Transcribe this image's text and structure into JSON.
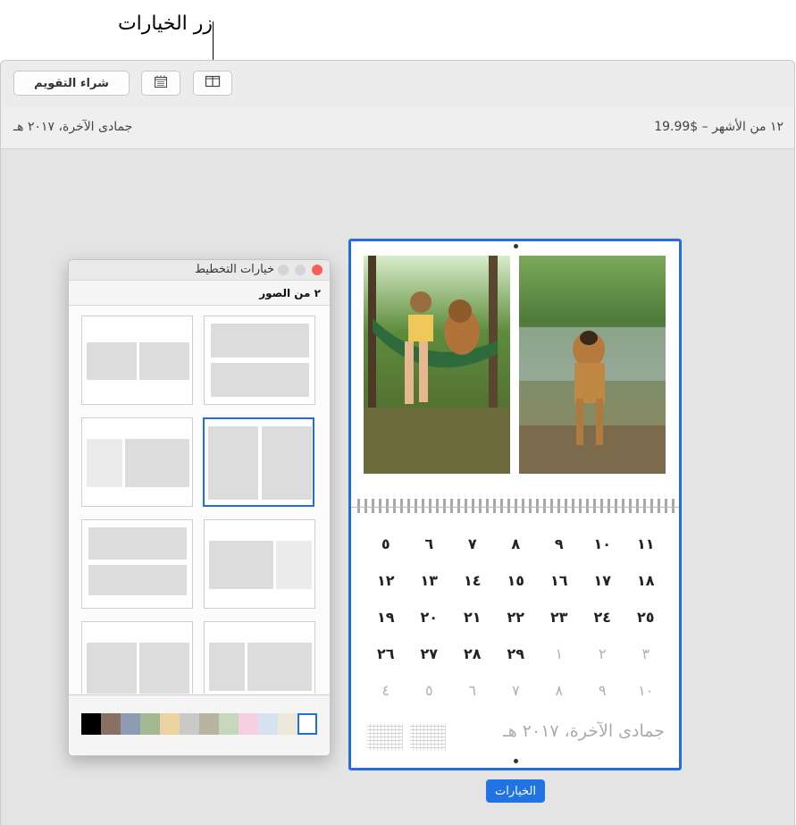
{
  "callout": {
    "label": "زر الخيارات"
  },
  "toolbar": {
    "buy_label": "شراء التقويم",
    "view_icon": "calendar-view-icon",
    "layout_icon": "layout-options-icon"
  },
  "info": {
    "date": "جمادى الآخرة، ٢٠١٧ هـ",
    "price": "١٢ من الأشهر – $19.99"
  },
  "calendar": {
    "weekday_rows": [
      [
        "١١",
        "١٠",
        "٩",
        "٨",
        "٧",
        "٦",
        "٥"
      ],
      [
        "١٨",
        "١٧",
        "١٦",
        "١٥",
        "١٤",
        "١٣",
        "١٢"
      ],
      [
        "٢٥",
        "٢٤",
        "٢٣",
        "٢٢",
        "٢١",
        "٢٠",
        "١٩"
      ],
      [
        "٣",
        "٢",
        "١",
        "٢٩",
        "٢٨",
        "٢٧",
        "٢٦"
      ],
      [
        "١٠",
        "٩",
        "٨",
        "٧",
        "٦",
        "٥",
        "٤"
      ]
    ],
    "dim_rows": [
      [
        false,
        false,
        false,
        false,
        false,
        false,
        false
      ],
      [
        false,
        false,
        false,
        false,
        false,
        false,
        false
      ],
      [
        false,
        false,
        false,
        false,
        false,
        false,
        false
      ],
      [
        true,
        true,
        true,
        false,
        false,
        false,
        false
      ],
      [
        true,
        true,
        true,
        true,
        true,
        true,
        true
      ]
    ],
    "footer_title": "جمادى الآخرة، ٢٠١٧ هـ"
  },
  "options_button": "الخيارات",
  "panel": {
    "title": "خيارات التخطيط",
    "subtitle": "٢ من الصور",
    "colors": [
      "#000000",
      "#8a7062",
      "#8f9bb4",
      "#a3b893",
      "#ecd3a0",
      "#c9c9c9",
      "#b9b4a0",
      "#c7d7bd",
      "#f6cfe1",
      "#d5e2ef",
      "#ede8d9"
    ]
  }
}
